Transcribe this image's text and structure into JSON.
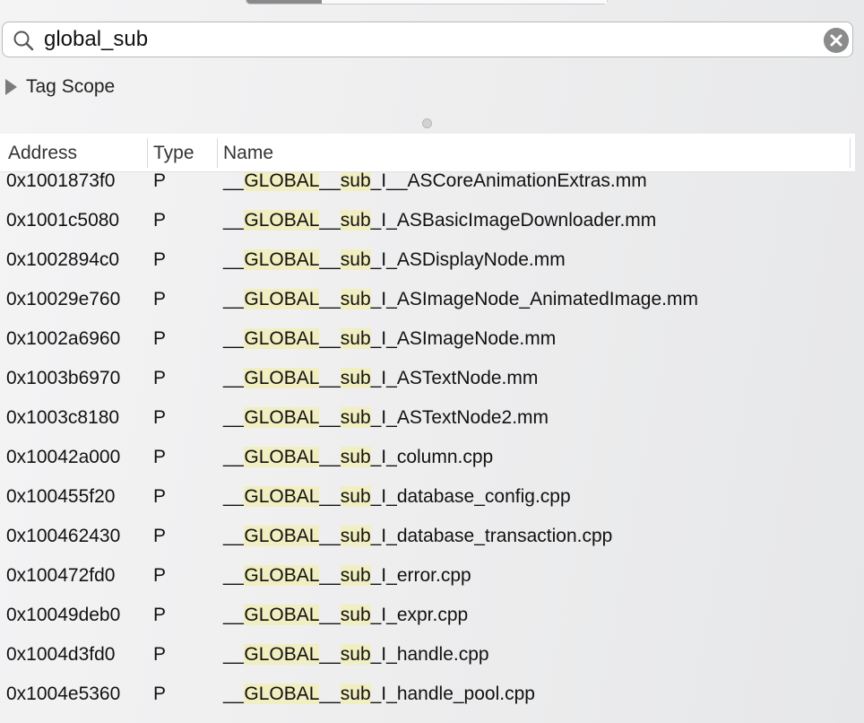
{
  "search": {
    "value": "global_sub",
    "icon": "search-icon",
    "clear_icon": "clear-icon"
  },
  "scope": {
    "label": "Tag Scope"
  },
  "table": {
    "columns": [
      "Address",
      "Type",
      "Name"
    ],
    "name_prefix": "__",
    "name_global": "GLOBAL",
    "name_mid": "__",
    "name_sub": "sub",
    "rows": [
      {
        "address": "0x1001873f0",
        "type": "P",
        "suffix": "_I__ASCoreAnimationExtras.mm"
      },
      {
        "address": "0x1001c5080",
        "type": "P",
        "suffix": "_I_ASBasicImageDownloader.mm"
      },
      {
        "address": "0x1002894c0",
        "type": "P",
        "suffix": "_I_ASDisplayNode.mm"
      },
      {
        "address": "0x10029e760",
        "type": "P",
        "suffix": "_I_ASImageNode_AnimatedImage.mm"
      },
      {
        "address": "0x1002a6960",
        "type": "P",
        "suffix": "_I_ASImageNode.mm"
      },
      {
        "address": "0x1003b6970",
        "type": "P",
        "suffix": "_I_ASTextNode.mm"
      },
      {
        "address": "0x1003c8180",
        "type": "P",
        "suffix": "_I_ASTextNode2.mm"
      },
      {
        "address": "0x10042a000",
        "type": "P",
        "suffix": "_I_column.cpp"
      },
      {
        "address": "0x100455f20",
        "type": "P",
        "suffix": "_I_database_config.cpp"
      },
      {
        "address": "0x100462430",
        "type": "P",
        "suffix": "_I_database_transaction.cpp"
      },
      {
        "address": "0x100472fd0",
        "type": "P",
        "suffix": "_I_error.cpp"
      },
      {
        "address": "0x10049deb0",
        "type": "P",
        "suffix": "_I_expr.cpp"
      },
      {
        "address": "0x1004d3fd0",
        "type": "P",
        "suffix": "_I_handle.cpp"
      },
      {
        "address": "0x1004e5360",
        "type": "P",
        "suffix": "_I_handle_pool.cpp"
      }
    ]
  },
  "colors": {
    "highlight": "#f1eec1",
    "header_bg": "#ffffff",
    "clear_button": "#8b8b8b"
  }
}
